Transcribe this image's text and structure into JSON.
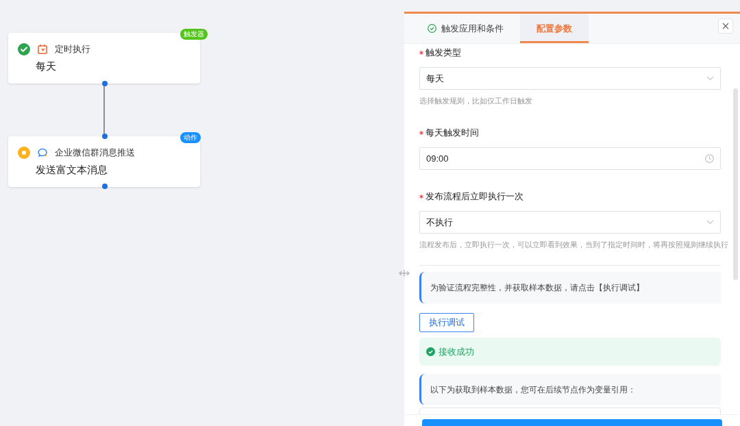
{
  "flow_nodes": [
    {
      "kind": "trigger",
      "done": true,
      "badge": {
        "label": "触发器",
        "kind": "trigger"
      },
      "title": "定时执行",
      "subtitle": "每天"
    },
    {
      "kind": "action",
      "done": false,
      "badge": {
        "label": "动作",
        "kind": "action"
      },
      "title": "企业微信群消息推送",
      "subtitle": "发送富文本消息"
    }
  ],
  "panel": {
    "tabs": [
      {
        "label": "触发应用和条件",
        "selected": false,
        "done": true
      },
      {
        "label": "配置参数",
        "selected": true,
        "done": false
      }
    ],
    "fields": [
      {
        "label": "触发类型",
        "required": true,
        "kind": "select",
        "value": "每天",
        "hint": "选择触发规则，比如仅工作日触发"
      },
      {
        "label": "每天触发时间",
        "required": true,
        "kind": "time",
        "value": "09:00"
      },
      {
        "label": "发布流程后立即执行一次",
        "required": true,
        "kind": "select",
        "value": "不执行",
        "hint": "流程发布后，立即执行一次，可以立即看到效果，当到了指定时间时，将再按照规则继续执行"
      }
    ],
    "debug_notice": "为验证流程完整性，并获取样本数据，请点击【执行调试】",
    "debug_button": "执行调试",
    "result": {
      "kind": "success",
      "message": "接收成功"
    },
    "sample_notice": "以下为获取到样本数据，您可在后续节点作为变量引用："
  }
}
